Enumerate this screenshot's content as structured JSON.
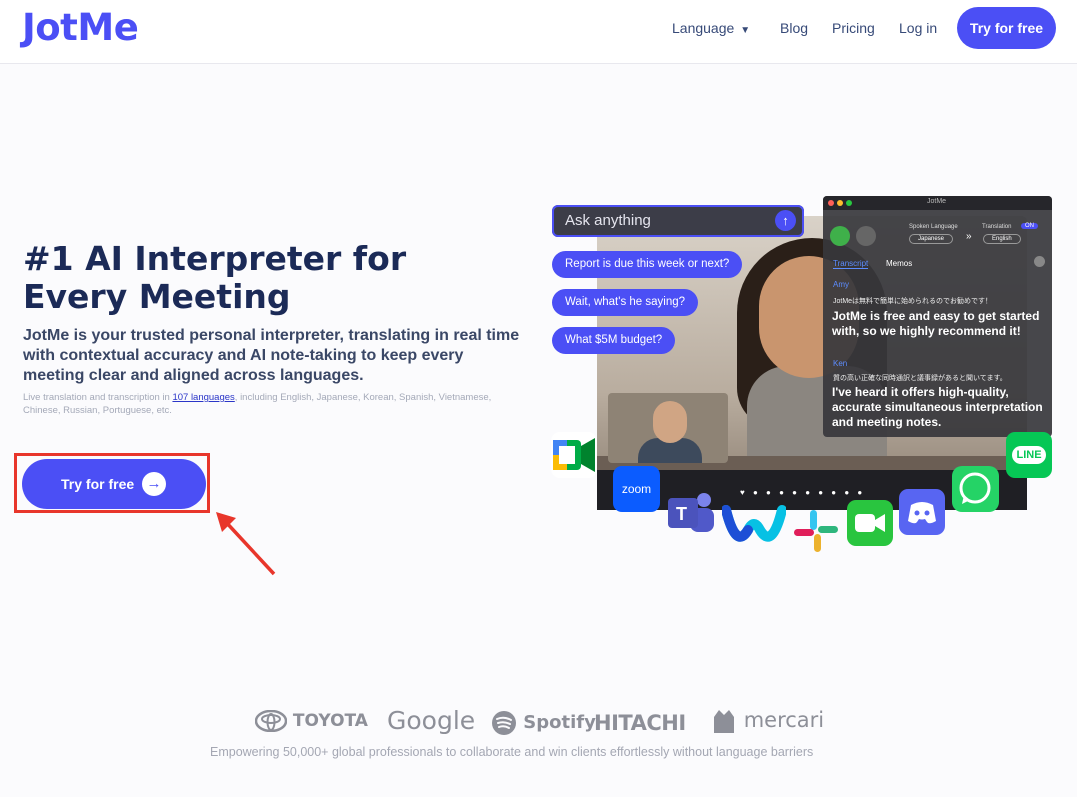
{
  "header": {
    "logo": "JotMe",
    "nav": {
      "language": "Language",
      "blog": "Blog",
      "pricing": "Pricing",
      "login": "Log in"
    },
    "cta": "Try for free"
  },
  "hero": {
    "title": "#1 AI Interpreter for Every Meeting",
    "description": "JotMe is your trusted personal interpreter, translating in real time with contextual accuracy and AI note-taking to keep every meeting clear and aligned across languages.",
    "small_prefix": "Live translation and transcription in ",
    "small_link": "107 languages",
    "small_suffix": ", including English, Japanese, Korean, Spanish, Vietnamese, Chinese, Russian, Portuguese, etc.",
    "cta": "Try for free"
  },
  "illustration": {
    "ask_placeholder": "Ask anything",
    "bubbles": [
      "Report is due this week or next?",
      "Wait, what's he saying?",
      "What $5M budget?"
    ],
    "panel": {
      "title": "JotMe",
      "spoken_label": "Spoken Language",
      "spoken_value": "Japanese",
      "translation_label": "Translation",
      "translation_toggle": "ON",
      "translation_value": "English",
      "tab_transcript": "Transcript",
      "tab_memos": "Memos",
      "entries": [
        {
          "speaker": "Amy",
          "original": "JotMeは無料で簡単に始められるのでお勧めです！",
          "translation": "JotMe is free and easy to get started with, so we highly recommend it!"
        },
        {
          "speaker": "Ken",
          "original": "質の高い正確な同時通訳と議事録があると聞いてます。",
          "translation": "I've heard it offers high-quality, accurate simultaneous interpretation and meeting notes."
        }
      ]
    },
    "apps": {
      "zoom": "zoom",
      "line": "LINE"
    }
  },
  "brands": [
    "TOYOTA",
    "Google",
    "Spotify",
    "HITACHI",
    "mercari"
  ],
  "tagline": "Empowering 50,000+ global professionals to collaborate and win clients effortlessly without language barriers"
}
